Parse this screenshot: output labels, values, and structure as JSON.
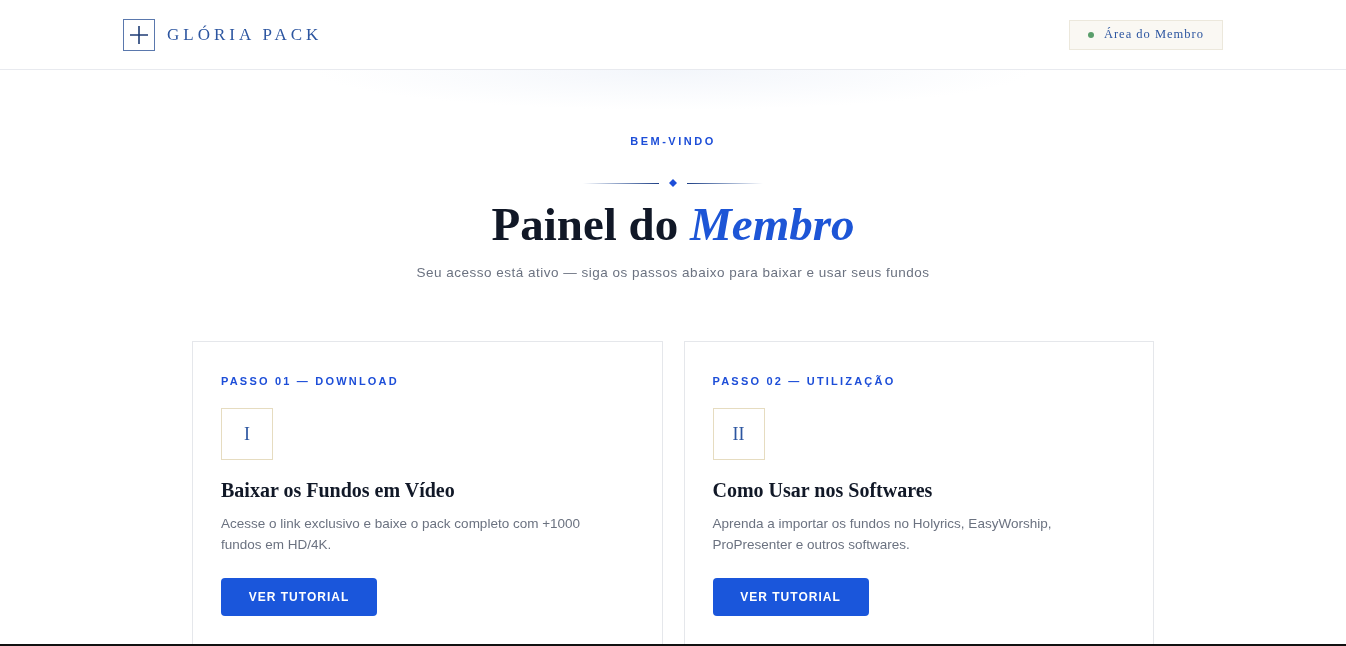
{
  "header": {
    "logo": {
      "text": "GLÓRIA PACK"
    },
    "member_badge": {
      "label": "Área do Membro"
    }
  },
  "hero": {
    "eyebrow": "BEM-VINDO",
    "title": "Painel do *Membro*",
    "subtitle": "Seu acesso está ativo — siga os passos abaixo para baixar e usar seus fundos"
  },
  "steps": [
    {
      "label": "PASSO 01 — DOWNLOAD",
      "numeral": "I",
      "title": "Baixar os Fundos em Vídeo",
      "description": "Acesse o link exclusivo e baixe o pack completo com +1000 fundos em HD/4K.",
      "button": "VER TUTORIAL"
    },
    {
      "label": "PASSO 02 — UTILIZAÇÃO",
      "numeral": "II",
      "title": "Como Usar nos Softwares",
      "description": "Aprenda a importar os fundos no Holyrics, EasyWorship, ProPresenter e outros softwares.",
      "button": "VER TUTORIAL"
    }
  ]
}
